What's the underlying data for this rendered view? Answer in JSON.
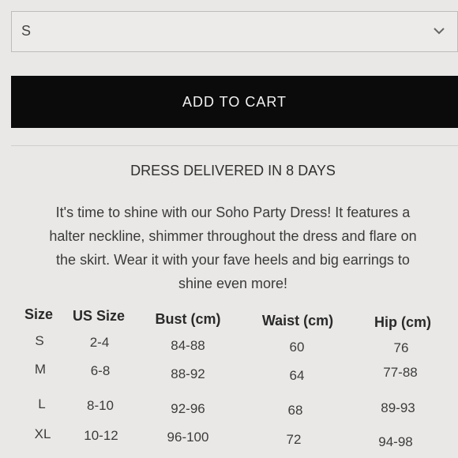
{
  "size_select": {
    "value": "S",
    "icon": "chevron-down-icon"
  },
  "add_to_cart_label": "ADD TO CART",
  "delivery_text": "DRESS DELIVERED IN 8 DAYS",
  "description": {
    "line1": "It's time to shine with our Soho Party Dress! It features a",
    "line2": "halter neckline, shimmer throughout the dress and flare on",
    "line3": "the skirt. Wear it with your fave heels and big earrings to",
    "line4": "shine even more!"
  },
  "size_chart": {
    "headers": [
      "Size",
      "US Size",
      "Bust (cm)",
      "Waist (cm)",
      "Hip (cm)"
    ],
    "rows": [
      [
        "S",
        "2-4",
        "84-88",
        "60",
        "76"
      ],
      [
        "M",
        "6-8",
        "88-92",
        "64",
        "77-88"
      ],
      [
        "L",
        "8-10",
        "92-96",
        "68",
        "89-93"
      ],
      [
        "XL",
        "10-12",
        "96-100",
        "72",
        "94-98"
      ]
    ]
  }
}
